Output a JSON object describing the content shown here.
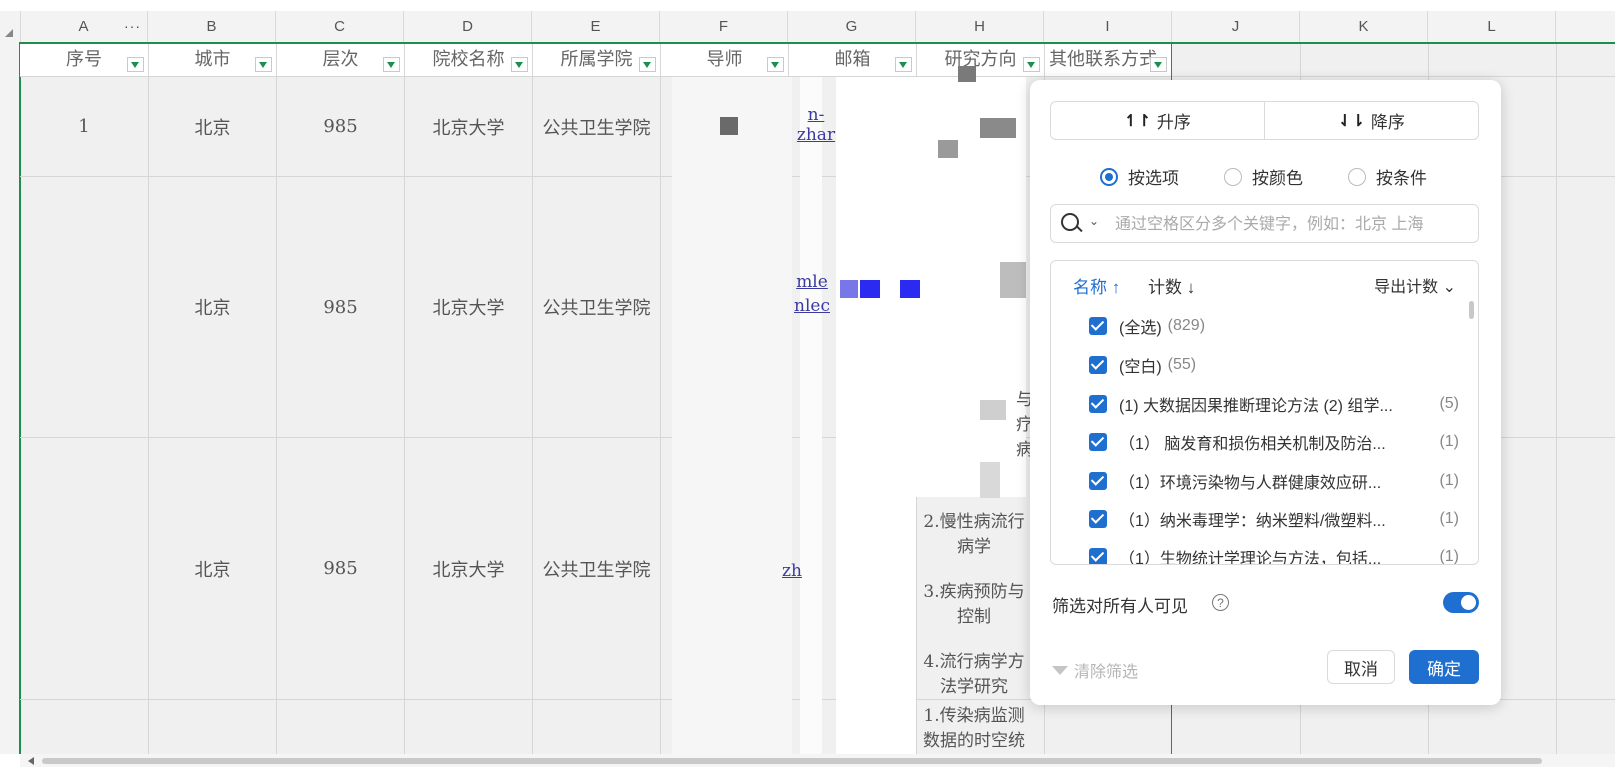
{
  "columns": [
    "A",
    "B",
    "C",
    "D",
    "E",
    "F",
    "G",
    "H",
    "I",
    "J",
    "K",
    "L"
  ],
  "column_a_menu": "···",
  "header_row": {
    "seq": "序号",
    "city": "城市",
    "level": "层次",
    "school": "院校名称",
    "college": "所属学院",
    "advisor": "导师",
    "email": "邮箱",
    "research": "研究方向",
    "other_contact": "其他联系方式"
  },
  "rows": [
    {
      "seq": "1",
      "city": "北京",
      "level": "985",
      "school": "北京大学",
      "college": "公共卫生学院",
      "email_fragment": "n-zhar"
    },
    {
      "seq": "",
      "city": "北京",
      "level": "985",
      "school": "北京大学",
      "college": "公共卫生学院",
      "email_fragment_1": "mle",
      "email_fragment_2": "nlec"
    },
    {
      "seq": "",
      "city": "北京",
      "level": "985",
      "school": "北京大学",
      "college": "公共卫生学院",
      "email_fragment": "zh",
      "research_lines": [
        "2.慢性病流行",
        "病学",
        "3.疾病预防与",
        "控制",
        "4.流行病学方",
        "法学研究"
      ]
    },
    {
      "seq": "",
      "research_lines": [
        "1.传染病监测",
        "数据的时空统"
      ]
    }
  ],
  "research_fragments": [
    "与",
    "疗",
    "病"
  ],
  "filter_panel": {
    "sort_asc": "升序",
    "sort_desc": "降序",
    "modes": [
      "按选项",
      "按颜色",
      "按条件"
    ],
    "selected_mode": "按选项",
    "search_placeholder": "通过空格区分多个关键字，例如：北京 上海",
    "list_header": {
      "name": "名称",
      "name_arrow": "↑",
      "count": "计数",
      "count_arrow": "↓",
      "export": "导出计数"
    },
    "items": [
      {
        "label": "(全选)",
        "count": "(829)",
        "checked": true
      },
      {
        "label": "(空白)",
        "count": "(55)",
        "checked": true
      },
      {
        "label": "(1) 大数据因果推断理论方法 (2) 组学...",
        "count": "(5)",
        "checked": true
      },
      {
        "label": "（1） 脑发育和损伤相关机制及防治...",
        "count": "(1)",
        "checked": true
      },
      {
        "label": "（1）环境污染物与人群健康效应研...",
        "count": "(1)",
        "checked": true
      },
      {
        "label": "（1）纳米毒理学：纳米塑料/微塑料...",
        "count": "(1)",
        "checked": true
      },
      {
        "label": "（1）生物统计学理论与方法，包括...",
        "count": "(1)",
        "checked": true
      }
    ],
    "visible_to_all_label": "筛选对所有人可见",
    "visible_to_all": true,
    "help": "?",
    "clear_label": "清除筛选",
    "cancel_label": "取消",
    "ok_label": "确定"
  },
  "colors": {
    "accent": "#1f6fd1",
    "grid_green": "#1e8e4e"
  }
}
